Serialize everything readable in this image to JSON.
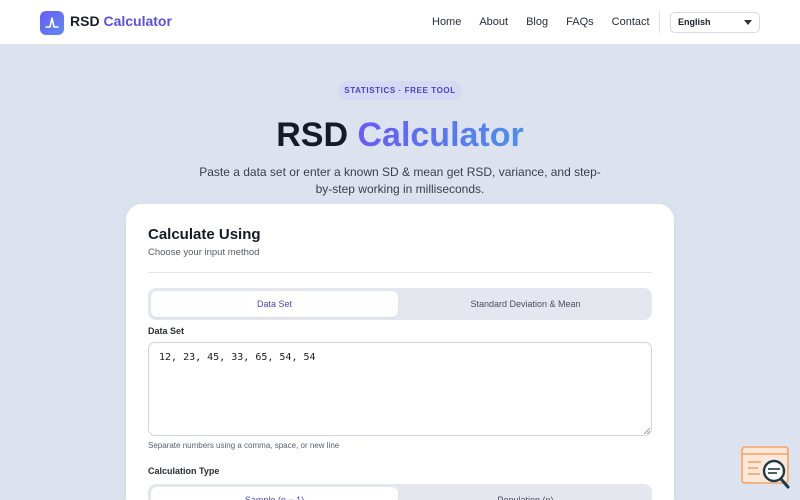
{
  "header": {
    "brand_prefix": "RSD",
    "brand_accent": "Calculator",
    "nav": [
      "Home",
      "About",
      "Blog",
      "FAQs",
      "Contact"
    ],
    "language": "English"
  },
  "hero": {
    "badge": "STATISTICS · FREE TOOL",
    "title_prefix": "RSD",
    "title_accent": "Calculator",
    "subtitle": "Paste a data set or enter a known SD & mean get RSD, variance, and step-by-step working in milliseconds."
  },
  "card": {
    "title": "Calculate Using",
    "subtitle": "Choose your input method",
    "method_tabs": [
      "Data Set",
      "Standard Deviation & Mean"
    ],
    "data_set_label": "Data Set",
    "data_set_value": "12, 23, 45, 33, 65, 54, 54",
    "hint": "Separate numbers using a comma, space, or new line",
    "calc_type_label": "Calculation Type",
    "calc_type_tabs": [
      "Sample (n − 1)",
      "Population (n)"
    ]
  },
  "colors": {
    "accent": "#5b4fe0",
    "background": "#dde3ee",
    "widget": "#f3a36b"
  },
  "icons": {
    "logo": "wave-peak-icon",
    "dropdown": "chevron-down-icon",
    "widget": "search-chat-icon"
  }
}
